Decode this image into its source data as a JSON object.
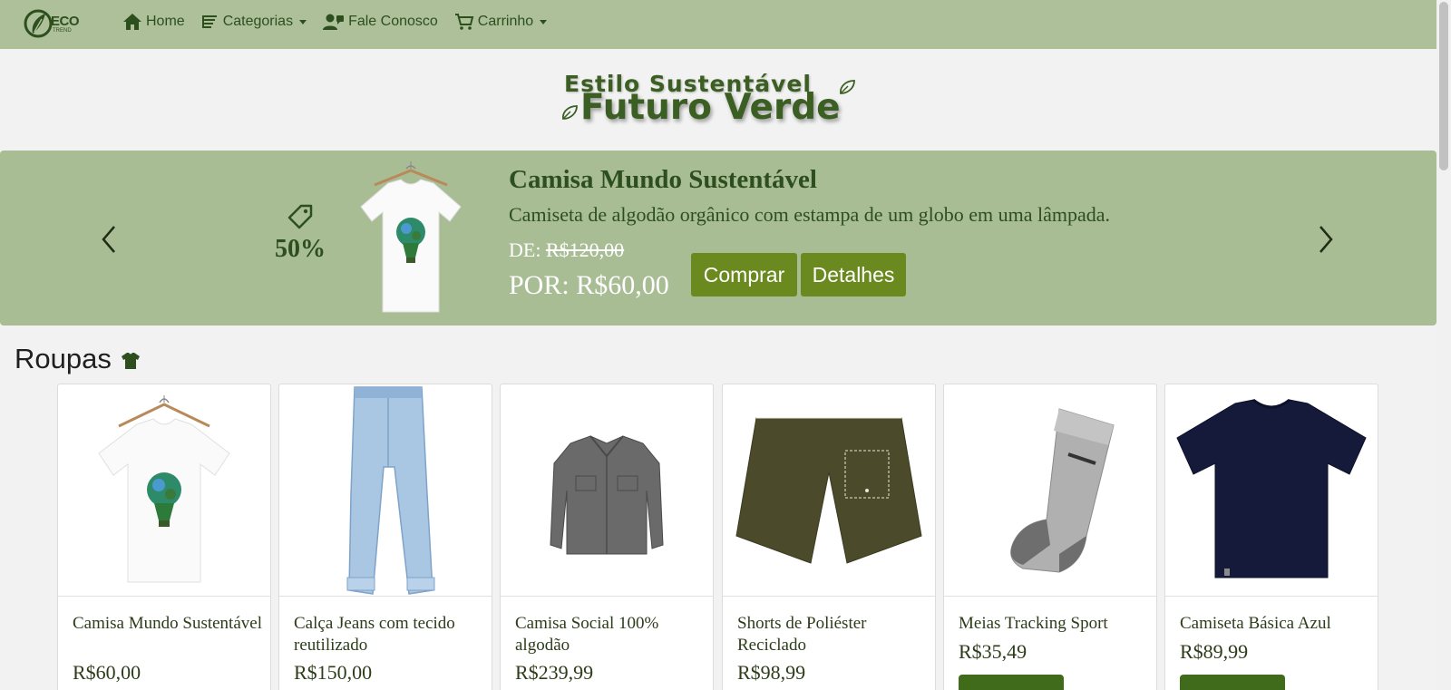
{
  "nav": {
    "logo_text": "ECO",
    "logo_sub": "TREND",
    "items": [
      {
        "label": "Home"
      },
      {
        "label": "Categorias"
      },
      {
        "label": "Fale Conosco"
      },
      {
        "label": "Carrinho"
      }
    ]
  },
  "hero": {
    "line1": "Estilo Sustentável",
    "line2": "Futuro Verde"
  },
  "carousel": {
    "discount": "50%",
    "title": "Camisa Mundo Sustentável",
    "description": "Camiseta de algodão orgânico com estampa de um globo em uma lâmpada.",
    "old_price_prefix": "DE:",
    "old_price": "R$120,00",
    "new_price": "POR: R$60,00",
    "buy_label": "Comprar",
    "details_label": "Detalhes"
  },
  "section": {
    "title": "Roupas"
  },
  "products": [
    {
      "name": "Camisa Mundo Sustentável",
      "price": "R$60,00",
      "icon": "tshirt-lightbulb"
    },
    {
      "name": "Calça Jeans com tecido reutilizado",
      "price": "R$150,00",
      "icon": "jeans"
    },
    {
      "name": "Camisa Social 100% algodão",
      "price": "R$239,99",
      "icon": "jacket"
    },
    {
      "name": "Shorts de Poliéster Reciclado",
      "price": "R$98,99",
      "icon": "shorts"
    },
    {
      "name": "Meias Tracking Sport",
      "price": "R$35,49",
      "icon": "sock"
    },
    {
      "name": "Camiseta Básica Azul",
      "price": "R$89,99",
      "icon": "tshirt-navy"
    }
  ],
  "colors": {
    "navbar": "#adc09a",
    "carousel": "#a9bd95",
    "accent": "#6a8a1f",
    "text_dark": "#2d4f1e"
  }
}
